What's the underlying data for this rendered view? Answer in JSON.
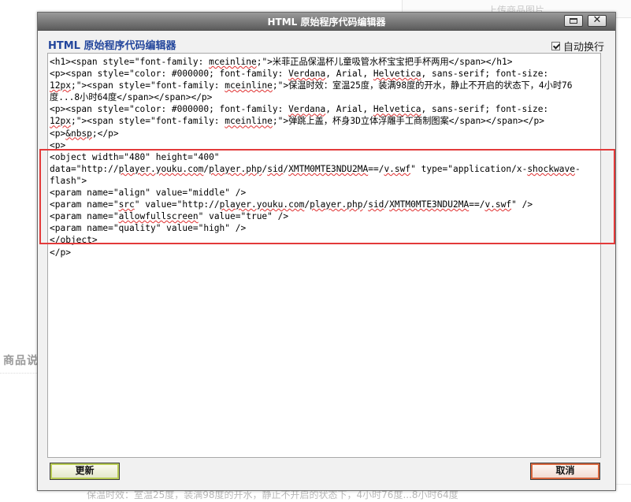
{
  "background": {
    "top_label": "上传商品图片",
    "side_label": "商品说",
    "bottom_text": "保温时效：室温25度，装满98度的开水，静止不开启的状态下，4小时76度...8小时64度"
  },
  "dialog": {
    "title": "HTML 原始程序代码编辑器",
    "heading": "HTML 原始程序代码编辑器",
    "wrap_label": "自动换行",
    "wrap_checked": true,
    "update_label": "更新",
    "cancel_label": "取消",
    "code_lines": [
      "<h1><span style=\"font-family: mceinline;\">米菲正品保温杯儿童吸管水杯宝宝把手杯两用</span></h1>",
      "<p><span style=\"color: #000000; font-family: Verdana, Arial, Helvetica, sans-serif; font-size:",
      "12px;\"><span style=\"font-family: mceinline;\">保温时效：室温25度，装满98度的开水，静止不开启的状态下，4小时76",
      "度...8小时64度</span></span></p>",
      "<p><span style=\"color: #000000; font-family: Verdana, Arial, Helvetica, sans-serif; font-size:",
      "12px;\"><span style=\"font-family: mceinline;\">弹跳上盖，杯身3D立体浮雕手工商制图案</span></span></p>",
      "<p>&nbsp;</p>",
      "<p>",
      "<object width=\"480\" height=\"400\"",
      "data=\"http://player.youku.com/player.php/sid/XMTM0MTE3NDU2MA==/v.swf\" type=\"application/x-shockwave-",
      "flash\">",
      "<param name=\"align\" value=\"middle\" />",
      "<param name=\"src\" value=\"http://player.youku.com/player.php/sid/XMTM0MTE3NDU2MA==/v.swf\" />",
      "<param name=\"allowfullscreen\" value=\"true\" />",
      "<param name=\"quality\" value=\"high\" />",
      "</object>",
      "</p>"
    ]
  },
  "colors": {
    "heading_blue": "#23469c",
    "highlight_red": "#e33a3a",
    "update_accent": "#b9cc55",
    "cancel_accent": "#d8683f"
  },
  "icons": {
    "maximize": "maximize-icon",
    "close": "close-icon",
    "checkbox": "checkbox-checked-icon"
  }
}
